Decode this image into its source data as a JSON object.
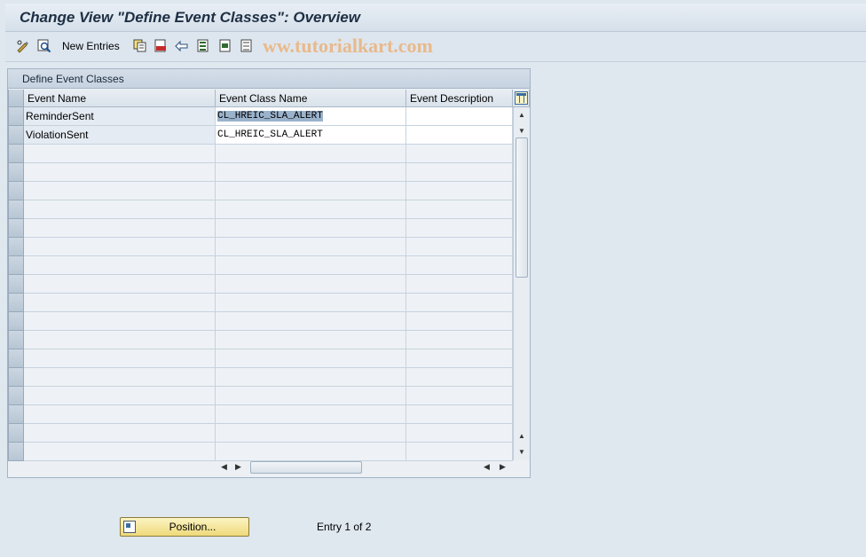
{
  "title": "Change View \"Define Event Classes\": Overview",
  "toolbar": {
    "new_entries_label": "New Entries",
    "watermark": "ww.tutorialkart.com"
  },
  "panel": {
    "title": "Define Event Classes",
    "columns": [
      "Event Name",
      "Event Class Name",
      "Event Description"
    ],
    "rows": [
      {
        "event_name": "ReminderSent",
        "event_class_name": "CL_HREIC_SLA_ALERT",
        "event_description": ""
      },
      {
        "event_name": "ViolationSent",
        "event_class_name": "CL_HREIC_SLA_ALERT",
        "event_description": ""
      }
    ]
  },
  "footer": {
    "position_label": "Position...",
    "entry_text": "Entry 1 of 2"
  },
  "icons": {
    "toolbar": [
      "display-change-icon",
      "search-icon",
      "copy-icon",
      "delete-icon",
      "undo-icon",
      "select-all-icon",
      "select-block-icon",
      "deselect-all-icon"
    ],
    "grid": "table-settings-icon",
    "position": "position-icon"
  }
}
